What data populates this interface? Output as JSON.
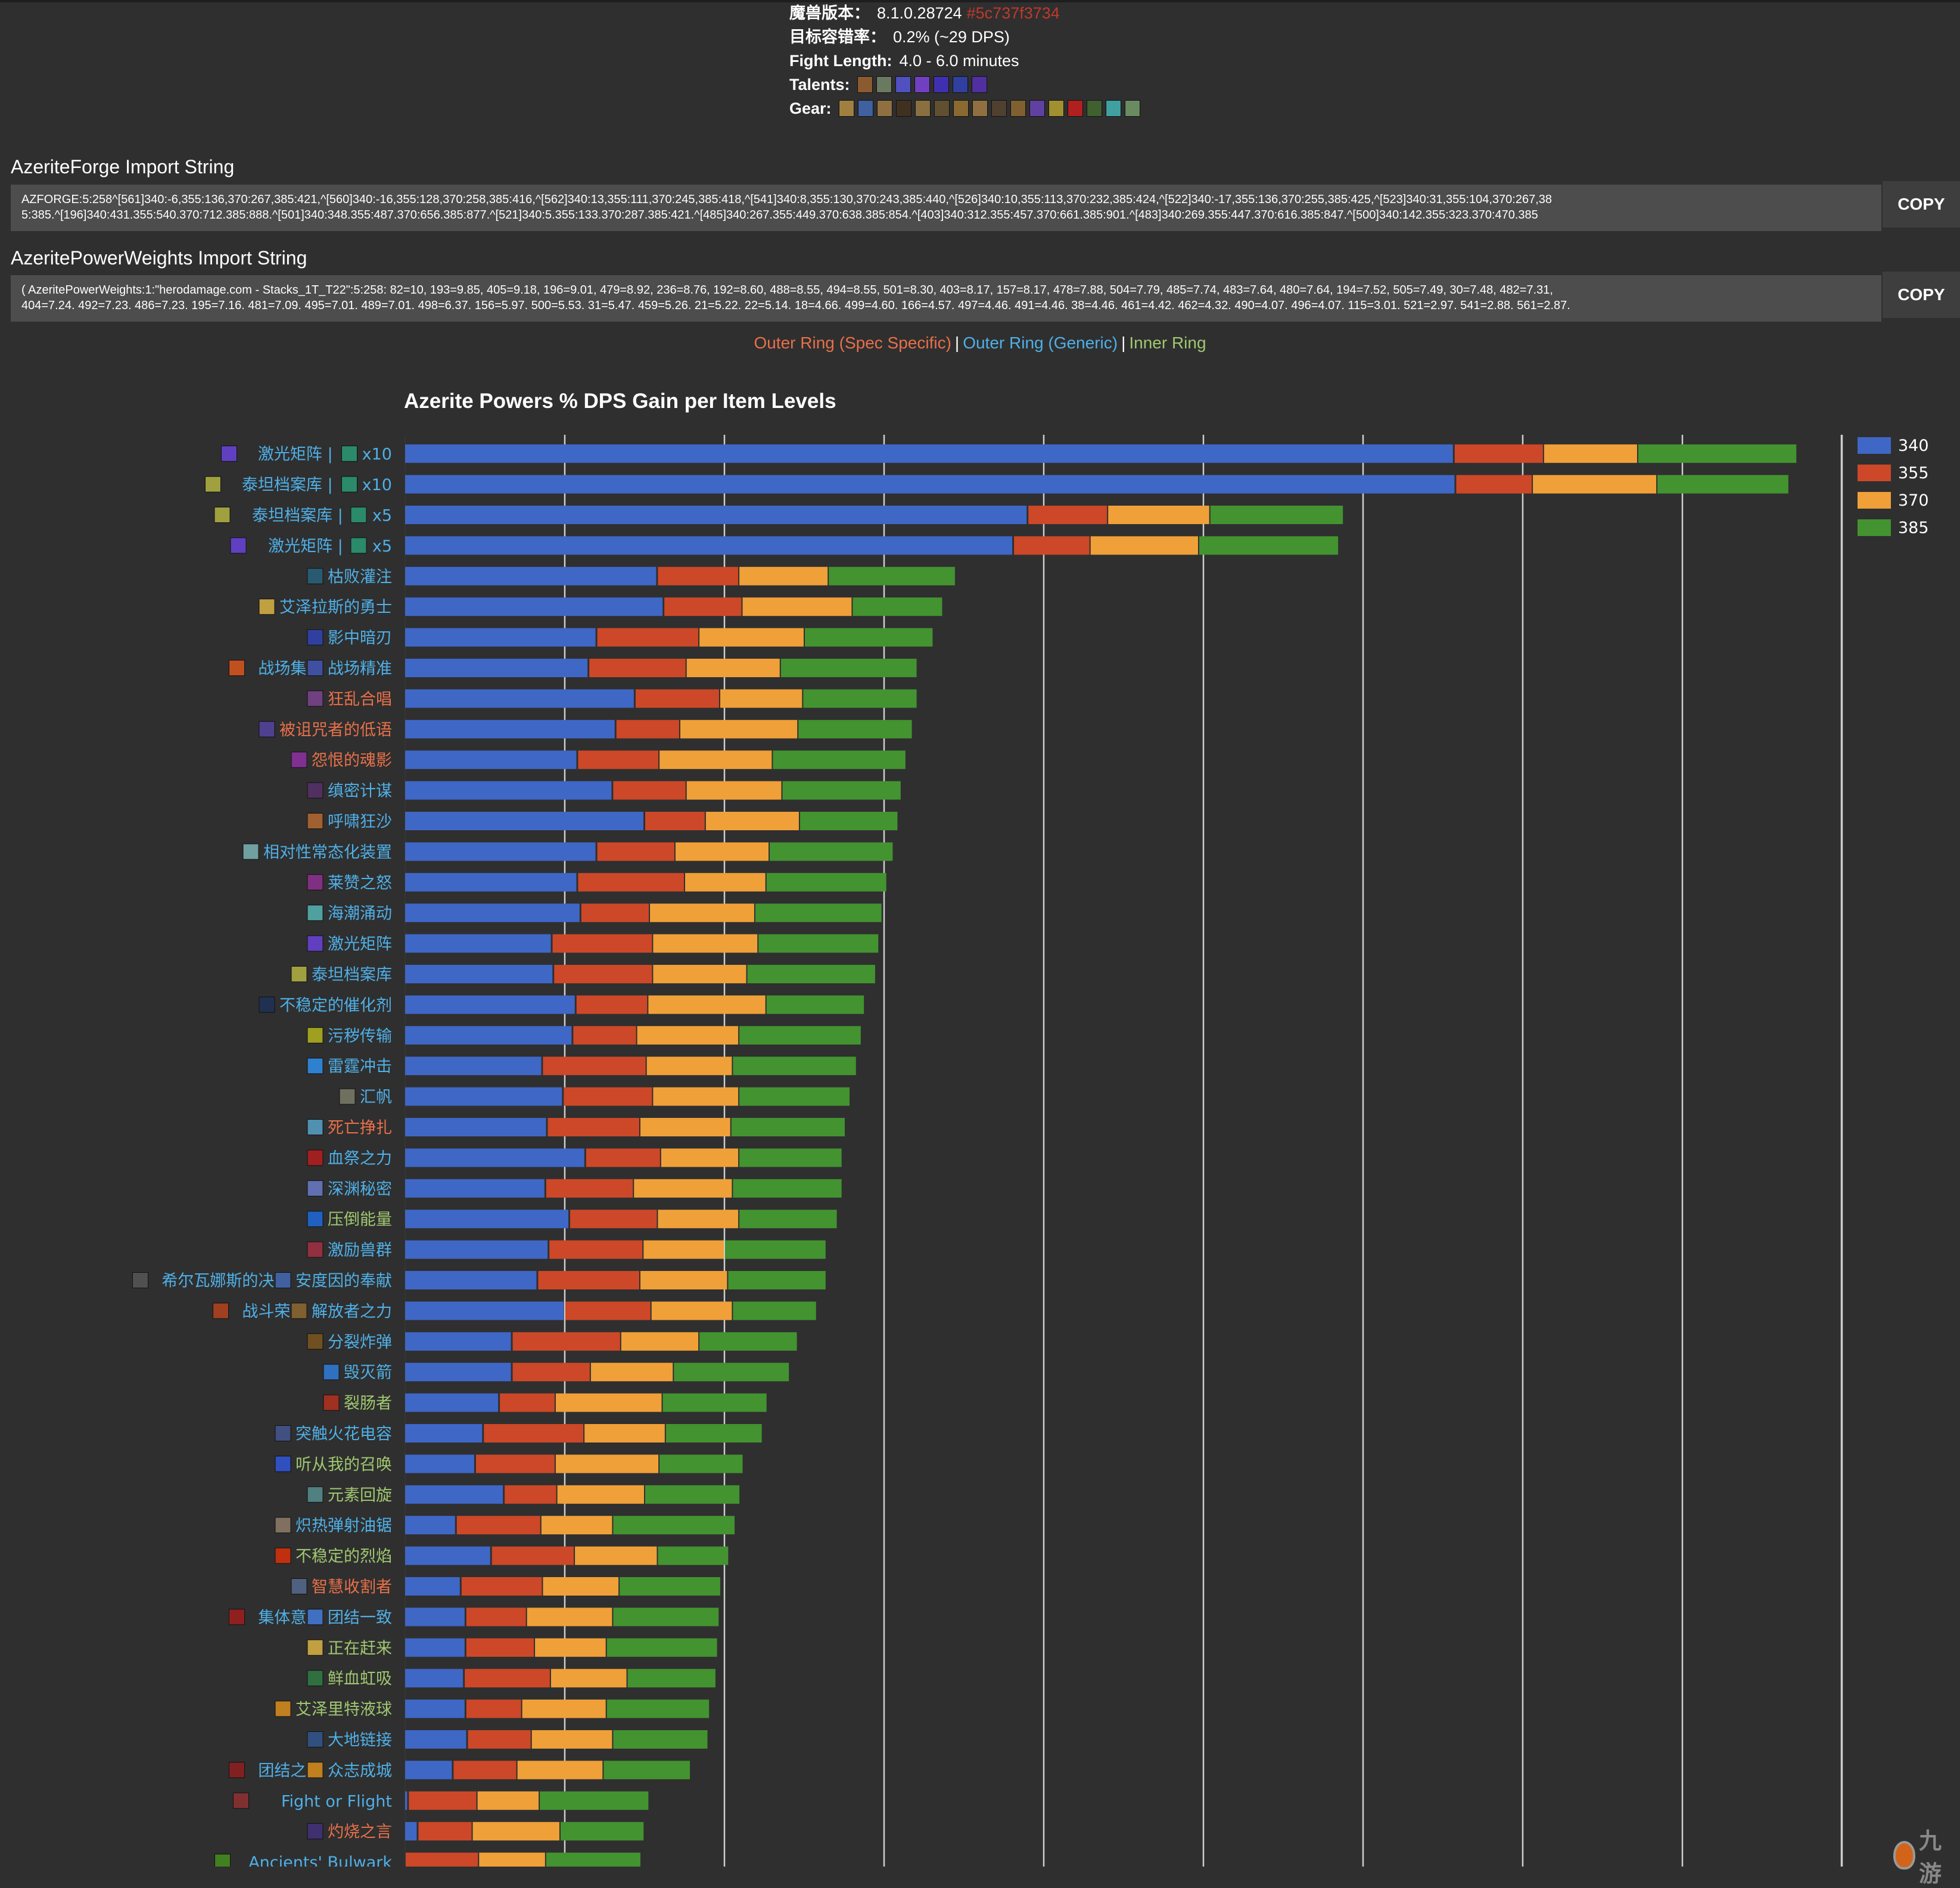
{
  "header": {
    "version_label": "魔兽版本：",
    "version_value": "8.1.0.28724",
    "version_hash": "#5c737f3734",
    "tolerance_label": "目标容错率：",
    "tolerance_value": "0.2% (~29 DPS)",
    "fight_length_label": "Fight Length:",
    "fight_length_value": "4.0 - 6.0 minutes",
    "talents_label": "Talents:",
    "talent_icons": [
      "#8a5a30",
      "#6a7a60",
      "#5050c0",
      "#7040c0",
      "#4030b0",
      "#3040a0",
      "#5030a0"
    ],
    "gear_label": "Gear:",
    "gear_icons": [
      "#a08040",
      "#4060a0",
      "#907040",
      "#403020",
      "#8a7040",
      "#605030",
      "#8a6a30",
      "#907040",
      "#504030",
      "#806030",
      "#6040a0",
      "#a09030",
      "#b02020",
      "#406030",
      "#40a0a0",
      "#6a8a60"
    ]
  },
  "azeriteforge": {
    "title": "AzeriteForge Import String",
    "line1": "AZFORGE:5:258^[561]340:-6,355:136,370:267,385:421,^[560]340:-16,355:128,370:258,385:416,^[562]340:13,355:111,370:245,385:418,^[541]340:8,355:130,370:243,385:440,^[526]340:10,355:113,370:232,385:424,^[522]340:-17,355:136,370:255,385:425,^[523]340:31,355:104,370:267,38",
    "line2": "5:385.^[196]340:431.355:540.370:712.385:888.^[501]340:348.355:487.370:656.385:877.^[521]340:5.355:133.370:287.385:421.^[485]340:267.355:449.370:638.385:854.^[403]340:312.355:457.370:661.385:901.^[483]340:269.355:447.370:616.385:847.^[500]340:142.355:323.370:470.385",
    "copy_label": "COPY"
  },
  "weights": {
    "title": "AzeritePowerWeights Import String",
    "line1": "( AzeritePowerWeights:1:\"herodamage.com - Stacks_1T_T22\":5:258: 82=10, 193=9.85, 405=9.18, 196=9.01, 479=8.92, 236=8.76, 192=8.60, 488=8.55, 494=8.55, 501=8.30, 403=8.17, 157=8.17, 478=7.88, 504=7.79, 485=7.74, 483=7.64, 480=7.64, 194=7.52, 505=7.49, 30=7.48, 482=7.31,",
    "line2": "404=7.24. 492=7.23. 486=7.23. 195=7.16. 481=7.09. 495=7.01. 489=7.01. 498=6.37. 156=5.97. 500=5.53. 31=5.47. 459=5.26. 21=5.22. 22=5.14. 18=4.66. 499=4.60. 166=4.57. 497=4.46. 491=4.46. 38=4.46. 461=4.42. 462=4.32. 490=4.07. 496=4.07. 115=3.01. 521=2.97. 541=2.88. 561=2.87.",
    "copy_label": "COPY"
  },
  "ring_legend": {
    "spec": "Outer Ring (Spec Specific)",
    "generic": "Outer Ring (Generic)",
    "inner": "Inner Ring",
    "separator": "|"
  },
  "colors": {
    "spec": "#e8704a",
    "generic": "#4fb0e8",
    "inner": "#a0c870",
    "s340": "#3f67c6",
    "s355": "#cc4828",
    "s370": "#f0a038",
    "s385": "#439330",
    "grid": "#cfcfcf",
    "background": "#2f2f2f"
  },
  "watermark": "九游",
  "chart_data": {
    "type": "bar",
    "orientation": "horizontal",
    "stacked": true,
    "title": "Azerite Powers % DPS Gain per Item Levels",
    "xlabel": "",
    "ylabel": "",
    "xlim": [
      0,
      9
    ],
    "value_note": "cumulative % DPS gain (values estimated in gridline units; axis has no printed tick labels)",
    "grid": true,
    "legend_position": "right",
    "series_names": [
      "340",
      "355",
      "370",
      "385"
    ],
    "rows": [
      {
        "label": "激光矩阵 | ",
        "suffix": "x10",
        "ring": "generic",
        "icons": [
          "#6040c0",
          "#2a8a6a"
        ],
        "cum": [
          6.57,
          7.13,
          7.72,
          8.71
        ]
      },
      {
        "label": "泰坦档案库 | ",
        "suffix": "x10",
        "ring": "generic",
        "icons": [
          "#a0a040",
          "#2a8a6a"
        ],
        "cum": [
          6.58,
          7.06,
          7.84,
          8.66
        ]
      },
      {
        "label": "泰坦档案库 | ",
        "suffix": "x5",
        "ring": "generic",
        "icons": [
          "#a0a040",
          "#2a8a6a"
        ],
        "cum": [
          3.9,
          4.4,
          5.04,
          5.87
        ]
      },
      {
        "label": "激光矩阵 | ",
        "suffix": "x5",
        "ring": "generic",
        "icons": [
          "#6040c0",
          "#2a8a6a"
        ],
        "cum": [
          3.81,
          4.29,
          4.97,
          5.84
        ]
      },
      {
        "label": "枯败灌注",
        "ring": "generic",
        "icons": [
          "#2a5a70"
        ],
        "cum": [
          1.58,
          2.09,
          2.65,
          3.44
        ]
      },
      {
        "label": "艾泽拉斯的勇士",
        "ring": "generic",
        "icons": [
          "#c0a040"
        ],
        "cum": [
          1.62,
          2.11,
          2.8,
          3.36
        ]
      },
      {
        "label": "影中暗刃",
        "ring": "generic",
        "icons": [
          "#3040a0"
        ],
        "cum": [
          1.2,
          1.84,
          2.5,
          3.3
        ]
      },
      {
        "label": "战场精准",
        "prefix": "战场集火",
        "ring": "generic",
        "icons": [
          "#c05020",
          "#4050a0"
        ],
        "cum": [
          1.15,
          1.76,
          2.35,
          3.2
        ]
      },
      {
        "label": "狂乱合唱",
        "ring": "spec",
        "icons": [
          "#704080"
        ],
        "cum": [
          1.44,
          1.97,
          2.49,
          3.2
        ]
      },
      {
        "label": "被诅咒者的低语",
        "ring": "spec",
        "icons": [
          "#504090"
        ],
        "cum": [
          1.32,
          1.72,
          2.46,
          3.17
        ]
      },
      {
        "label": "怨恨的魂影",
        "ring": "spec",
        "icons": [
          "#803090"
        ],
        "cum": [
          1.08,
          1.59,
          2.3,
          3.13
        ]
      },
      {
        "label": "缜密计谋",
        "ring": "generic",
        "icons": [
          "#503060"
        ],
        "cum": [
          1.3,
          1.76,
          2.36,
          3.1
        ]
      },
      {
        "label": "呼啸狂沙",
        "ring": "generic",
        "icons": [
          "#a06030"
        ],
        "cum": [
          1.5,
          1.88,
          2.47,
          3.08
        ]
      },
      {
        "label": "相对性常态化装置",
        "ring": "generic",
        "icons": [
          "#70a0a0"
        ],
        "cum": [
          1.2,
          1.69,
          2.28,
          3.05
        ]
      },
      {
        "label": "莱赞之怒",
        "ring": "generic",
        "icons": [
          "#803080"
        ],
        "cum": [
          1.08,
          1.75,
          2.26,
          3.01
        ]
      },
      {
        "label": "海潮涌动",
        "ring": "generic",
        "icons": [
          "#50a0a0"
        ],
        "cum": [
          1.1,
          1.53,
          2.19,
          2.98
        ]
      },
      {
        "label": "激光矩阵",
        "ring": "generic",
        "icons": [
          "#6040c0"
        ],
        "cum": [
          0.92,
          1.55,
          2.21,
          2.96
        ]
      },
      {
        "label": "泰坦档案库",
        "ring": "generic",
        "icons": [
          "#a0a040"
        ],
        "cum": [
          0.93,
          1.55,
          2.14,
          2.94
        ]
      },
      {
        "label": "不稳定的催化剂",
        "ring": "generic",
        "icons": [
          "#203050"
        ],
        "cum": [
          1.07,
          1.52,
          2.26,
          2.87
        ]
      },
      {
        "label": "污秽传输",
        "ring": "generic",
        "icons": [
          "#a0a020"
        ],
        "cum": [
          1.05,
          1.45,
          2.09,
          2.85
        ]
      },
      {
        "label": "雷霆冲击",
        "ring": "generic",
        "icons": [
          "#3080d0"
        ],
        "cum": [
          0.86,
          1.51,
          2.05,
          2.82
        ]
      },
      {
        "label": "汇帆",
        "ring": "generic",
        "icons": [
          "#707060"
        ],
        "cum": [
          0.99,
          1.55,
          2.09,
          2.78
        ]
      },
      {
        "label": "死亡挣扎",
        "ring": "spec",
        "icons": [
          "#5090b0"
        ],
        "cum": [
          0.89,
          1.47,
          2.04,
          2.75
        ]
      },
      {
        "label": "血祭之力",
        "ring": "generic",
        "icons": [
          "#a02020"
        ],
        "cum": [
          1.13,
          1.6,
          2.09,
          2.73
        ]
      },
      {
        "label": "深渊秘密",
        "ring": "generic",
        "icons": [
          "#6070b0"
        ],
        "cum": [
          0.88,
          1.43,
          2.05,
          2.73
        ]
      },
      {
        "label": "压倒能量",
        "ring": "inner",
        "icons": [
          "#2060c0"
        ],
        "cum": [
          1.03,
          1.58,
          2.09,
          2.7
        ]
      },
      {
        "label": "激励兽群",
        "ring": "generic",
        "icons": [
          "#903040"
        ],
        "cum": [
          0.9,
          1.49,
          2.0,
          2.63
        ]
      },
      {
        "label": "安度因的奉献",
        "prefix": "希尔瓦娜斯的决心",
        "ring": "generic",
        "icons": [
          "#505050",
          "#4060a0"
        ],
        "cum": [
          0.83,
          1.47,
          2.02,
          2.63
        ]
      },
      {
        "label": "解放者之力",
        "prefix": "战斗荣耀",
        "ring": "generic",
        "icons": [
          "#a04020",
          "#806030"
        ],
        "cum": [
          1.0,
          1.54,
          2.05,
          2.57
        ]
      },
      {
        "label": "分裂炸弹",
        "ring": "generic",
        "icons": [
          "#705020"
        ],
        "cum": [
          0.67,
          1.35,
          1.84,
          2.45
        ]
      },
      {
        "label": "毁灭箭",
        "ring": "generic",
        "icons": [
          "#3070c0"
        ],
        "cum": [
          0.67,
          1.16,
          1.68,
          2.4
        ]
      },
      {
        "label": "裂肠者",
        "ring": "inner",
        "icons": [
          "#a03020"
        ],
        "cum": [
          0.59,
          0.94,
          1.61,
          2.26
        ]
      },
      {
        "label": "突触火花电容",
        "ring": "generic",
        "icons": [
          "#405080"
        ],
        "cum": [
          0.49,
          1.12,
          1.63,
          2.23
        ]
      },
      {
        "label": "听从我的召唤",
        "ring": "inner",
        "icons": [
          "#3050c0"
        ],
        "cum": [
          0.44,
          0.94,
          1.59,
          2.11
        ]
      },
      {
        "label": "元素回旋",
        "ring": "inner",
        "icons": [
          "#508080"
        ],
        "cum": [
          0.62,
          0.95,
          1.5,
          2.09
        ]
      },
      {
        "label": "炽热弹射油锯",
        "ring": "generic",
        "icons": [
          "#807060"
        ],
        "cum": [
          0.32,
          0.85,
          1.3,
          2.06
        ]
      },
      {
        "label": "不稳定的烈焰",
        "ring": "inner",
        "icons": [
          "#c03010"
        ],
        "cum": [
          0.54,
          1.06,
          1.58,
          2.02
        ]
      },
      {
        "label": "智慧收割者",
        "ring": "spec",
        "icons": [
          "#506080"
        ],
        "cum": [
          0.35,
          0.86,
          1.34,
          1.97
        ]
      },
      {
        "label": "团结一致",
        "prefix": "集体意志",
        "ring": "generic",
        "icons": [
          "#902020",
          "#4070c0"
        ],
        "cum": [
          0.38,
          0.76,
          1.3,
          1.96
        ]
      },
      {
        "label": "正在赶来",
        "ring": "inner",
        "icons": [
          "#c0a040"
        ],
        "cum": [
          0.38,
          0.81,
          1.26,
          1.95
        ]
      },
      {
        "label": "鲜血虹吸",
        "ring": "inner",
        "icons": [
          "#307040"
        ],
        "cum": [
          0.37,
          0.91,
          1.39,
          1.94
        ]
      },
      {
        "label": "艾泽里特液球",
        "ring": "inner",
        "icons": [
          "#c08020"
        ],
        "cum": [
          0.38,
          0.73,
          1.26,
          1.9
        ]
      },
      {
        "label": "大地链接",
        "ring": "generic",
        "icons": [
          "#305080"
        ],
        "cum": [
          0.39,
          0.79,
          1.3,
          1.89
        ]
      },
      {
        "label": "众志成城",
        "prefix": "团结之力",
        "ring": "generic",
        "icons": [
          "#802020",
          "#c08020"
        ],
        "cum": [
          0.3,
          0.7,
          1.24,
          1.78
        ]
      },
      {
        "label": "Fight or Flight",
        "ring": "generic",
        "icons": [
          "#803030"
        ],
        "cum": [
          0.02,
          0.45,
          0.84,
          1.52
        ]
      },
      {
        "label": "灼烧之言",
        "ring": "spec",
        "icons": [
          "#403070"
        ],
        "cum": [
          0.08,
          0.42,
          0.97,
          1.49
        ]
      },
      {
        "label": "Ancients' Bulwark",
        "ring": "generic",
        "icons": [
          "#408020"
        ],
        "cum": [
          0.0,
          0.46,
          0.88,
          1.47
        ]
      }
    ]
  }
}
